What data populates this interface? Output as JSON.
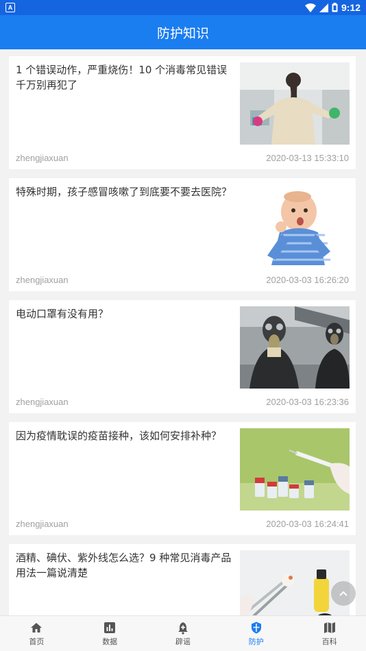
{
  "status": {
    "time": "9:12",
    "notification_icon": "A"
  },
  "header": {
    "title": "防护知识"
  },
  "articles": [
    {
      "title": "1 个错误动作，严重烧伤！10 个消毒常见错误千万别再犯了",
      "author": "zhengjiaxuan",
      "date": "2020-03-13 15:33:10",
      "image": "woman-cleaning-window"
    },
    {
      "title": "特殊时期，孩子感冒咳嗽了到底要不要去医院？",
      "author": "zhengjiaxuan",
      "date": "2020-03-03 16:26:20",
      "image": "baby-coughing"
    },
    {
      "title": "电动口罩有没有用？",
      "author": "zhengjiaxuan",
      "date": "2020-03-03 16:23:36",
      "image": "people-gas-masks"
    },
    {
      "title": "因为疫情耽误的疫苗接种，该如何安排补种？",
      "author": "zhengjiaxuan",
      "date": "2020-03-03 16:24:41",
      "image": "vaccine-syringe"
    },
    {
      "title": "酒精、碘伏、紫外线怎么选？9 种常见消毒产品用法一篇说清楚",
      "author": "",
      "date": "",
      "image": "disinfectant-products"
    }
  ],
  "tabs": [
    {
      "label": "首页",
      "icon": "home-icon"
    },
    {
      "label": "数据",
      "icon": "chart-icon"
    },
    {
      "label": "辟谣",
      "icon": "rumor-icon"
    },
    {
      "label": "防护",
      "icon": "shield-icon"
    },
    {
      "label": "百科",
      "icon": "map-icon"
    }
  ],
  "colors": {
    "primary": "#1a7df0",
    "statusbar": "#1565e0",
    "active_tab": "#1a7df0"
  }
}
